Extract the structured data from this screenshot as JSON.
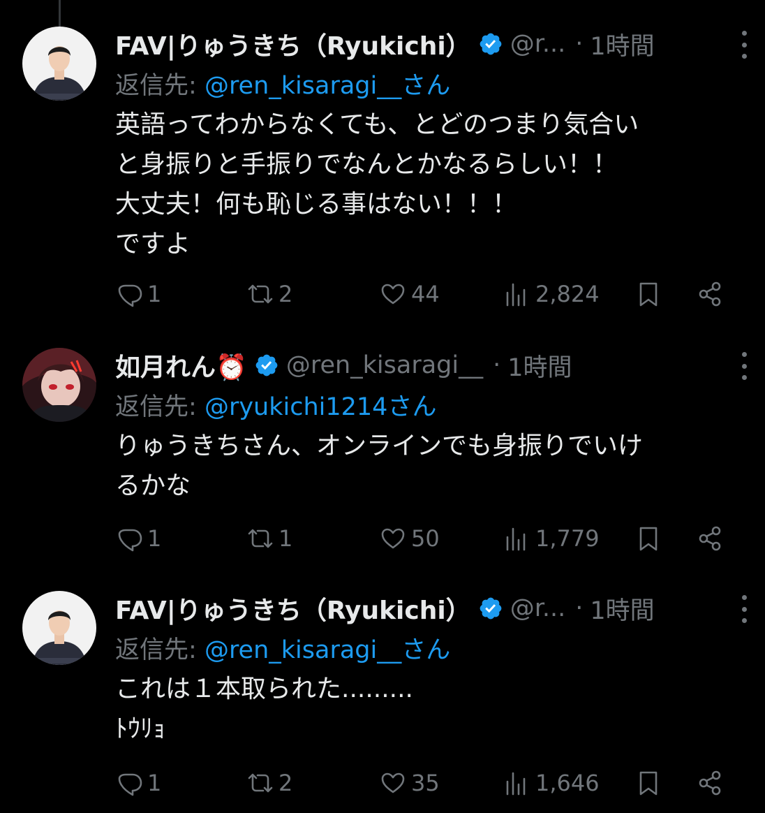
{
  "tweets": [
    {
      "name": "FAV|りゅうきち（Ryukichi）",
      "handle": "@r...",
      "time_sep": "·",
      "time": "1時間",
      "reply_label": "返信先:",
      "reply_mention": "@ren_kisaragi__さん",
      "text": "英語ってわからなくても、とどのつまり気合い\nと身振りと手振りでなんとかなるらしい！！\n大丈夫！何も恥じる事はない！！！\nですよ",
      "replies": "1",
      "retweets": "2",
      "likes": "44",
      "views": "2,824"
    },
    {
      "name": "如月れん⏰",
      "handle": "@ren_kisaragi__",
      "time_sep": "·",
      "time": "1時間",
      "reply_label": "返信先:",
      "reply_mention": "@ryukichi1214さん",
      "text": "りゅうきちさん、オンラインでも身振りでいけ\nるかな",
      "replies": "1",
      "retweets": "1",
      "likes": "50",
      "views": "1,779"
    },
    {
      "name": "FAV|りゅうきち（Ryukichi）",
      "handle": "@r...",
      "time_sep": "·",
      "time": "1時間",
      "reply_label": "返信先:",
      "reply_mention": "@ren_kisaragi__さん",
      "text": "これは１本取られた.........\nﾄｳﾘｮ",
      "replies": "1",
      "retweets": "2",
      "likes": "35",
      "views": "1,646"
    }
  ],
  "icons": {
    "verified": "verified-badge-icon",
    "more": "more-dots-icon",
    "reply": "reply-icon",
    "retweet": "retweet-icon",
    "like": "heart-icon",
    "views": "views-chart-icon",
    "bookmark": "bookmark-icon",
    "share": "share-icon"
  },
  "colors": {
    "background": "#000000",
    "text": "#e7e9ea",
    "muted": "#71767b",
    "link": "#1d9bf0",
    "verified": "#1d9bf0"
  }
}
